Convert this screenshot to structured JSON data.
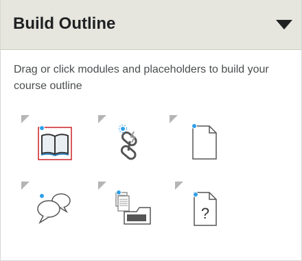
{
  "panel": {
    "title": "Build Outline",
    "instructions": "Drag or click modules and placeholders to build your course outline"
  },
  "modules": [
    {
      "icon": "book-icon"
    },
    {
      "icon": "link-icon"
    },
    {
      "icon": "document-icon"
    },
    {
      "icon": "discussion-icon"
    },
    {
      "icon": "dropbox-icon"
    },
    {
      "icon": "quiz-icon"
    }
  ],
  "colors": {
    "header_bg": "#e6e6df",
    "title_text": "#202122",
    "body_text": "#494c4e",
    "selected_border": "#cd2026",
    "accent_blue": "#2f9fe8",
    "corner_gray": "#b5b5b5"
  }
}
